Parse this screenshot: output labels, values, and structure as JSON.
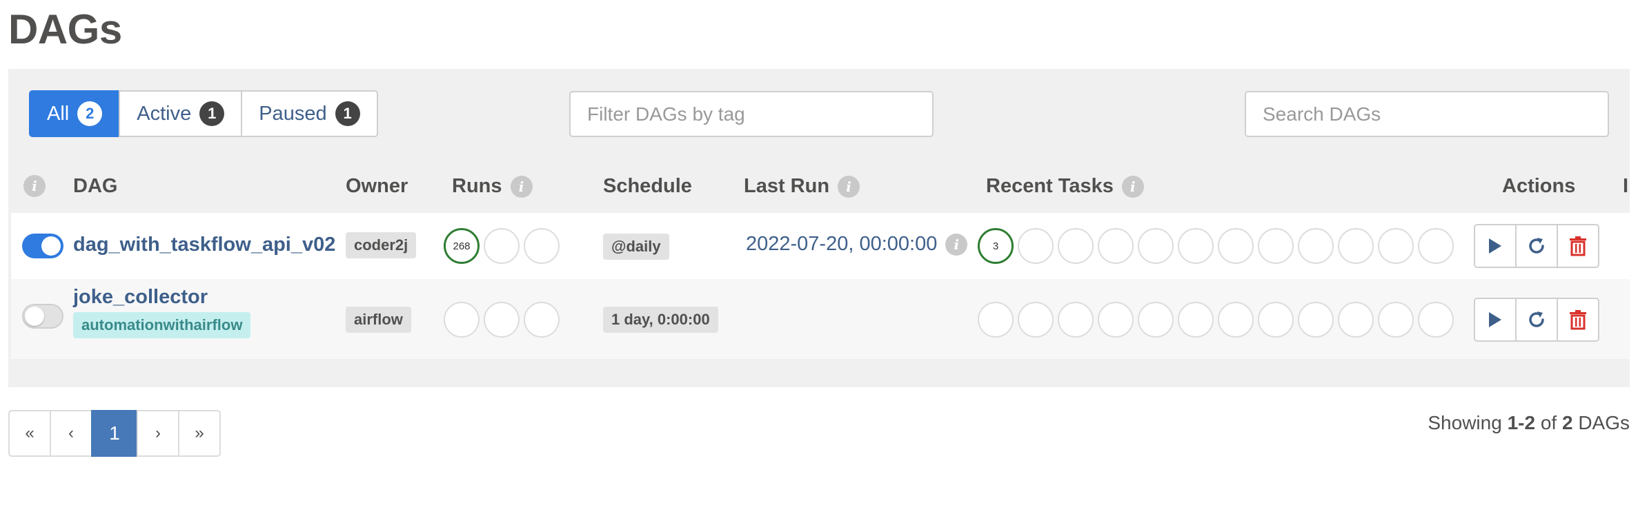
{
  "page": {
    "title": "DAGs"
  },
  "filters": {
    "tabs": [
      {
        "label": "All",
        "count": "2"
      },
      {
        "label": "Active",
        "count": "1"
      },
      {
        "label": "Paused",
        "count": "1"
      }
    ],
    "tag_placeholder": "Filter DAGs by tag",
    "search_placeholder": "Search DAGs"
  },
  "table": {
    "headers": {
      "dag": "DAG",
      "owner": "Owner",
      "runs": "Runs",
      "schedule": "Schedule",
      "last_run": "Last Run",
      "recent_tasks": "Recent Tasks",
      "actions": "Actions",
      "links": "I"
    },
    "rows": [
      {
        "dag_id": "dag_with_taskflow_api_v02",
        "active": true,
        "owner": "coder2j",
        "runs_success": "268",
        "schedule": "@daily",
        "last_run": "2022-07-20, 00:00:00",
        "recent_tasks_success": "3",
        "tag": ""
      },
      {
        "dag_id": "joke_collector",
        "active": false,
        "owner": "airflow",
        "runs_success": "",
        "schedule": "1 day, 0:00:00",
        "last_run": "",
        "recent_tasks_success": "",
        "tag": "automationwithairflow"
      }
    ]
  },
  "pagination": {
    "first": "«",
    "prev": "‹",
    "current": "1",
    "next": "›",
    "last": "»"
  },
  "summary": {
    "prefix": "Showing",
    "range": "1-2",
    "of": "of",
    "total": "2",
    "suffix": "DAGs"
  },
  "colors": {
    "primary": "#2f7be0",
    "link": "#3e5f8a",
    "success": "#2e7d32",
    "danger": "#d9322b",
    "tag_bg": "#c5efef"
  },
  "icons": {
    "trigger": "play-icon",
    "refresh": "refresh-icon",
    "delete": "trash-icon",
    "info": "info-icon"
  }
}
